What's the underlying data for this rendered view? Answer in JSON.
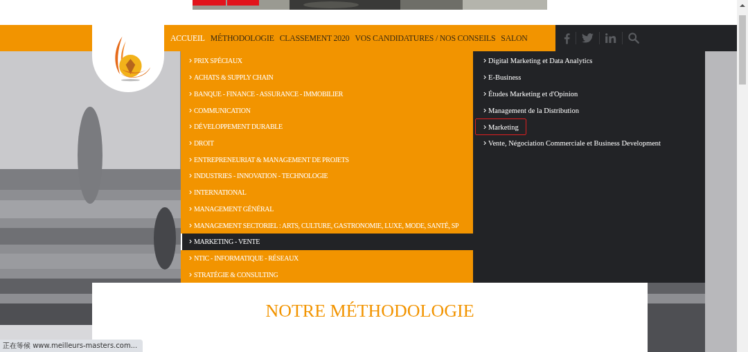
{
  "nav": {
    "items": [
      {
        "label": "ACCUEIL",
        "selected": true
      },
      {
        "label": "MÉTHODOLOGIE",
        "selected": false
      },
      {
        "label": "CLASSEMENT 2020",
        "selected": false
      },
      {
        "label": "VOS CANDIDATURES / NOS CONSEILS",
        "selected": false
      },
      {
        "label": "SALON",
        "selected": false
      }
    ]
  },
  "menu": {
    "items": [
      {
        "label": "PRIX SPÉCIAUX",
        "selected": false
      },
      {
        "label": "ACHATS & SUPPLY CHAIN",
        "selected": false
      },
      {
        "label": "BANQUE - FINANCE - ASSURANCE - IMMOBILIER",
        "selected": false
      },
      {
        "label": "COMMUNICATION",
        "selected": false
      },
      {
        "label": "DÉVELOPPEMENT DURABLE",
        "selected": false
      },
      {
        "label": "DROIT",
        "selected": false
      },
      {
        "label": "ENTREPRENEURIAT & MANAGEMENT DE PROJETS",
        "selected": false
      },
      {
        "label": "INDUSTRIES - INNOVATION - TECHNOLOGIE",
        "selected": false
      },
      {
        "label": "INTERNATIONAL",
        "selected": false
      },
      {
        "label": "MANAGEMENT GÉNÉRAL",
        "selected": false
      },
      {
        "label": "MANAGEMENT SECTORIEL : ARTS, CULTURE, GASTRONOMIE, LUXE, MODE, SANTÉ, SP",
        "selected": false
      },
      {
        "label": "MARKETING - VENTE",
        "selected": true
      },
      {
        "label": "NTIC - INFORMATIQUE - RÉSEAUX",
        "selected": false
      },
      {
        "label": "STRATÉGIE & CONSULTING",
        "selected": false
      }
    ]
  },
  "submenu": {
    "items": [
      {
        "label": "Digital Marketing et Data Analytics",
        "outlined": false
      },
      {
        "label": "E-Business",
        "outlined": false
      },
      {
        "label": "Études Marketing et d'Opinion",
        "outlined": false
      },
      {
        "label": "Management de la Distribution",
        "outlined": false
      },
      {
        "label": "Marketing",
        "outlined": true
      },
      {
        "label": "Vente, Négociation Commerciale et Business Development",
        "outlined": false
      }
    ]
  },
  "section": {
    "title": "NOTRE MÉTHODOLOGIE"
  },
  "status_bar": {
    "text": "正在等候 www.meilleurs-masters.com..."
  }
}
